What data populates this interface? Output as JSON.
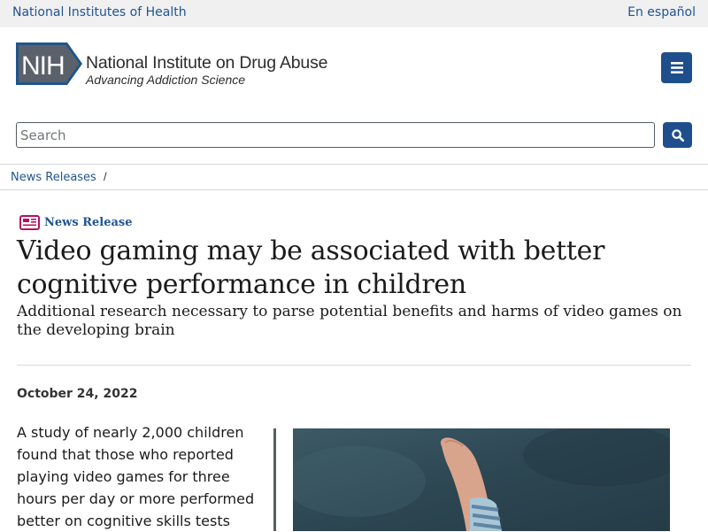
{
  "topbar": {
    "nih_label": "National Institutes of Health",
    "espanol_label": "En español"
  },
  "header": {
    "logo_badge": "NIH",
    "institute_name": "National Institute on Drug Abuse",
    "tagline": "Advancing Addiction Science",
    "menu_icon": "menu-icon"
  },
  "search": {
    "placeholder": "Search",
    "value": "",
    "button_icon": "search-icon"
  },
  "breadcrumb": {
    "items": [
      {
        "label": "News Releases"
      }
    ],
    "separator": "/"
  },
  "article": {
    "kicker_icon": "newspaper-icon",
    "kicker": "News Release",
    "headline": "Video gaming may be associated with better cognitive performance in children",
    "subhead": "Additional research necessary to parse potential benefits and harms of video games on the developing brain",
    "date": "October 24, 2022",
    "lead": "A study of nearly 2,000 children found that those who reported playing video games for three hours per day or more performed better on cognitive skills tests"
  },
  "colors": {
    "link": "#205493",
    "button": "#1f4e8c",
    "kicker_icon": "#b5105e",
    "topbar_bg": "#f0f0f0"
  }
}
